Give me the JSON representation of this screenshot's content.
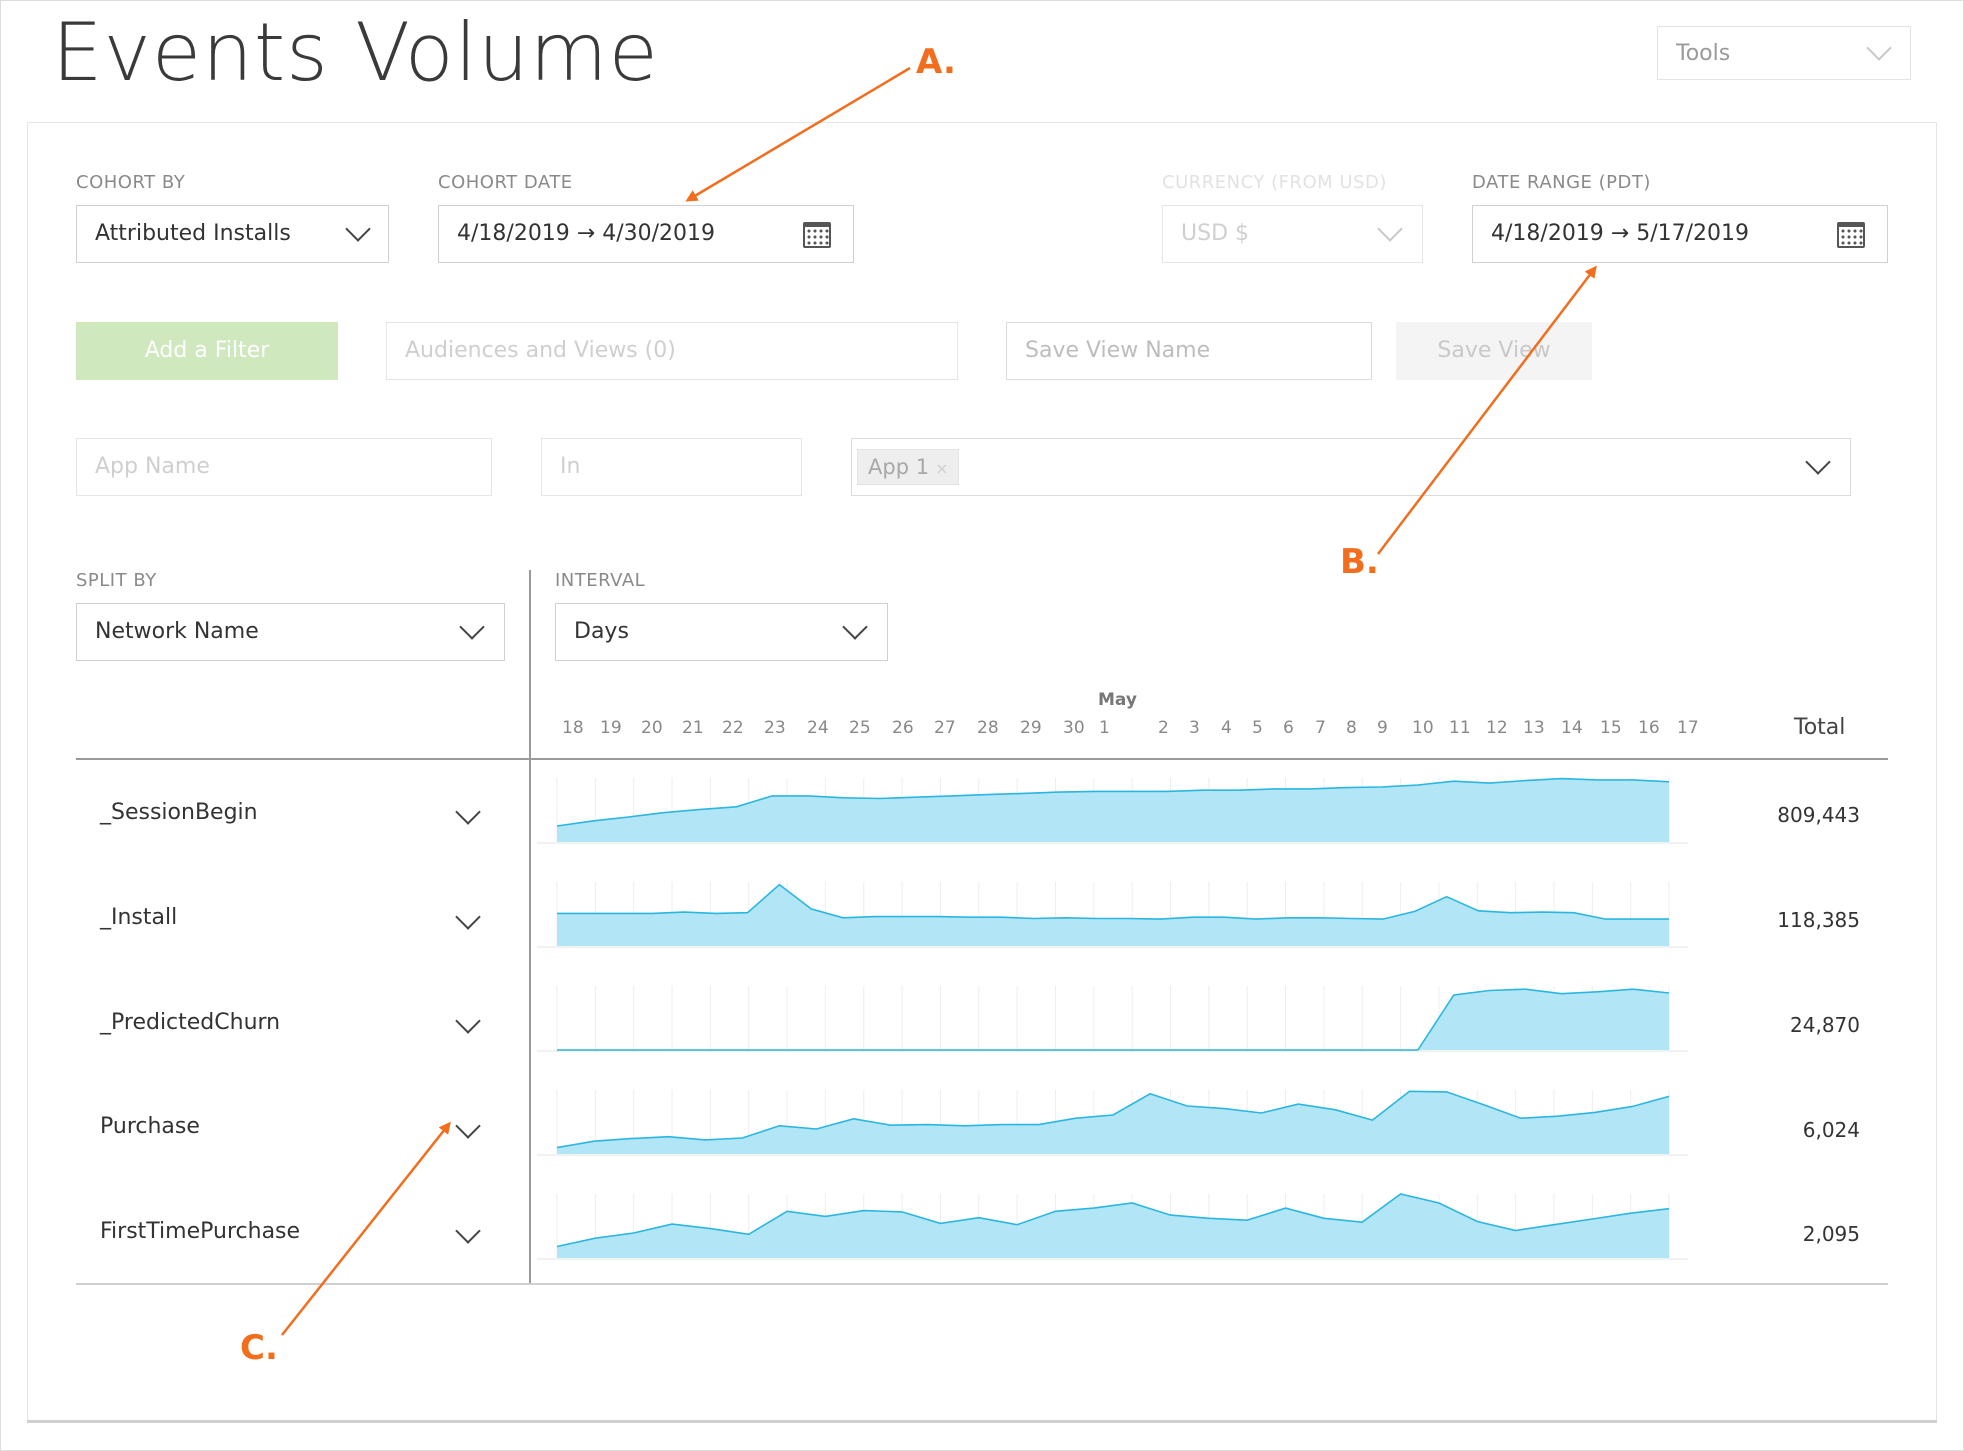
{
  "page": {
    "title": "Events Volume"
  },
  "tools": {
    "label": "Tools"
  },
  "filters": {
    "cohort_by": {
      "label": "COHORT BY",
      "value": "Attributed Installs"
    },
    "cohort_date": {
      "label": "COHORT DATE",
      "value": "4/18/2019 → 4/30/2019"
    },
    "currency": {
      "label": "CURRENCY (FROM USD)",
      "value": "USD $"
    },
    "date_range": {
      "label": "DATE RANGE (PDT)",
      "value": "4/18/2019 → 5/17/2019"
    },
    "add_filter": "Add a Filter",
    "audiences_placeholder": "Audiences and Views (0)",
    "save_view_placeholder": "Save View Name",
    "save_view_button": "Save View",
    "app_name_placeholder": "App Name",
    "in_placeholder": "In",
    "app_tag": "App 1",
    "app_tag_remove": "×"
  },
  "split_by": {
    "label": "SPLIT BY",
    "value": "Network Name"
  },
  "interval": {
    "label": "INTERVAL",
    "value": "Days"
  },
  "table": {
    "month_label": "May",
    "total_header": "Total",
    "dates": [
      "18",
      "19",
      "20",
      "21",
      "22",
      "23",
      "24",
      "25",
      "26",
      "27",
      "28",
      "29",
      "30",
      "1",
      "2",
      "3",
      "4",
      "5",
      "6",
      "7",
      "8",
      "9",
      "10",
      "11",
      "12",
      "13",
      "14",
      "15",
      "16",
      "17"
    ],
    "rows": [
      {
        "name": "_SessionBegin",
        "total": "809,443"
      },
      {
        "name": "_Install",
        "total": "118,385"
      },
      {
        "name": "_PredictedChurn",
        "total": "24,870"
      },
      {
        "name": "Purchase",
        "total": "6,024"
      },
      {
        "name": "FirstTimePurchase",
        "total": "2,095"
      }
    ]
  },
  "sparklines": {
    "type": "area",
    "color": "#2bb6e0",
    "fill": "#b2e6f6",
    "series": [
      {
        "row": "_SessionBegin",
        "values": [
          0.25,
          0.33,
          0.39,
          0.46,
          0.51,
          0.55,
          0.72,
          0.72,
          0.69,
          0.68,
          0.7,
          0.72,
          0.74,
          0.76,
          0.78,
          0.79,
          0.79,
          0.79,
          0.81,
          0.81,
          0.83,
          0.83,
          0.85,
          0.86,
          0.89,
          0.95,
          0.92,
          0.96,
          0.99,
          0.97,
          0.97,
          0.94
        ]
      },
      {
        "row": "_Install",
        "values": [
          0.51,
          0.51,
          0.51,
          0.51,
          0.53,
          0.51,
          0.52,
          0.96,
          0.58,
          0.44,
          0.46,
          0.46,
          0.46,
          0.45,
          0.45,
          0.43,
          0.44,
          0.43,
          0.43,
          0.42,
          0.45,
          0.45,
          0.42,
          0.44,
          0.44,
          0.43,
          0.42,
          0.54,
          0.77,
          0.55,
          0.52,
          0.53,
          0.52,
          0.42,
          0.42,
          0.42
        ]
      },
      {
        "row": "_PredictedChurn",
        "values": [
          0,
          0,
          0,
          0,
          0,
          0,
          0,
          0,
          0,
          0,
          0,
          0,
          0,
          0,
          0,
          0,
          0,
          0,
          0,
          0,
          0,
          0,
          0,
          0,
          0,
          0.86,
          0.93,
          0.95,
          0.88,
          0.91,
          0.95,
          0.89
        ]
      },
      {
        "row": "Purchase",
        "values": [
          0.1,
          0.2,
          0.24,
          0.27,
          0.22,
          0.25,
          0.44,
          0.39,
          0.55,
          0.45,
          0.46,
          0.44,
          0.46,
          0.46,
          0.56,
          0.61,
          0.94,
          0.75,
          0.71,
          0.64,
          0.78,
          0.69,
          0.53,
          0.98,
          0.97,
          0.77,
          0.56,
          0.59,
          0.65,
          0.74,
          0.9
        ]
      },
      {
        "row": "FirstTimePurchase",
        "values": [
          0.18,
          0.31,
          0.39,
          0.53,
          0.46,
          0.37,
          0.73,
          0.65,
          0.74,
          0.72,
          0.54,
          0.63,
          0.52,
          0.73,
          0.78,
          0.86,
          0.67,
          0.62,
          0.59,
          0.78,
          0.62,
          0.56,
          1.0,
          0.86,
          0.57,
          0.43,
          0.52,
          0.61,
          0.7,
          0.77
        ]
      }
    ]
  },
  "annotations": {
    "a": "A.",
    "b": "B.",
    "c": "C."
  },
  "colors": {
    "accent": "#f26d1c",
    "primary_button": "#cfe8be",
    "spark_fill": "#b2e6f6",
    "spark_line": "#2bb6e0"
  },
  "icons": {
    "calendar": "calendar-icon",
    "dropdown": "chevron-down-icon"
  }
}
